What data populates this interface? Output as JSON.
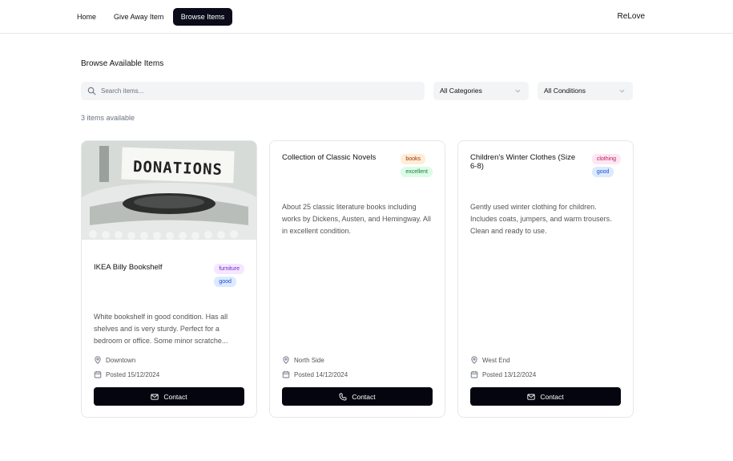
{
  "nav": {
    "items": [
      {
        "label": "Home"
      },
      {
        "label": "Give Away Item"
      },
      {
        "label": "Browse Items",
        "active": true
      }
    ],
    "brand": "ReLove"
  },
  "page": {
    "title": "Browse Available Items",
    "count_text": "3 items available"
  },
  "filters": {
    "search_placeholder": "Search items...",
    "category_selected": "All Categories",
    "condition_selected": "All Conditions"
  },
  "items": [
    {
      "title": "IKEA Billy Bookshelf",
      "image_text": "DONATIONS",
      "category": "furniture",
      "condition": "good",
      "description": "White bookshelf in good condition. Has all shelves and is very sturdy. Perfect for a bedroom or office. Some minor scratche...",
      "location": "Downtown",
      "posted": "Posted 15/12/2024",
      "contact_label": "Contact",
      "contact_icon": "mail-icon"
    },
    {
      "title": "Collection of Classic Novels",
      "category": "books",
      "condition": "excellent",
      "description": "About 25 classic literature books including works by Dickens, Austen, and Hemingway. All in excellent condition.",
      "location": "North Side",
      "posted": "Posted 14/12/2024",
      "contact_label": "Contact",
      "contact_icon": "phone-icon"
    },
    {
      "title": "Children's Winter Clothes (Size 6-8)",
      "category": "clothing",
      "condition": "good",
      "description": "Gently used winter clothing for children. Includes coats, jumpers, and warm trousers. Clean and ready to use.",
      "location": "West End",
      "posted": "Posted 13/12/2024",
      "contact_label": "Contact",
      "contact_icon": "mail-icon"
    }
  ],
  "colors": {
    "primary": "#0b0b1a",
    "muted_bg": "#f3f4f6",
    "border": "#e5e7eb",
    "badge_furniture_bg": "#f3e8ff",
    "badge_furniture_fg": "#7e22ce",
    "badge_books_bg": "#ffedd5",
    "badge_books_fg": "#9a3412",
    "badge_clothing_bg": "#fce7f3",
    "badge_clothing_fg": "#be185d",
    "badge_good_bg": "#dbeafe",
    "badge_good_fg": "#1d4ed8",
    "badge_excellent_bg": "#dcfce7",
    "badge_excellent_fg": "#15803d"
  }
}
